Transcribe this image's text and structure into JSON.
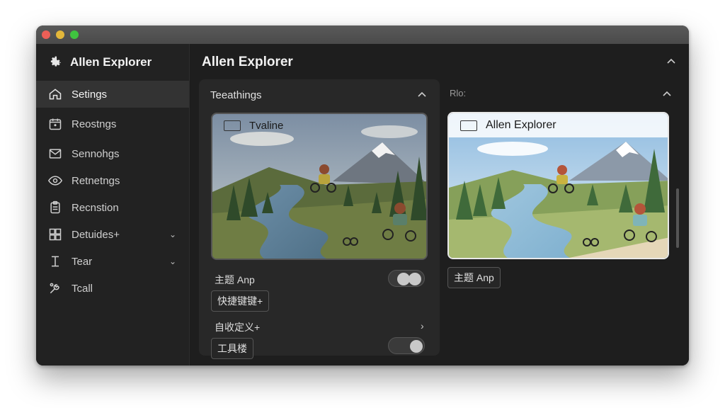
{
  "window": {
    "traffic_lights": [
      "close",
      "minimize",
      "maximize"
    ]
  },
  "sidebar": {
    "app_title": "Allen Explorer",
    "items": [
      {
        "label": "Setings",
        "icon": "home-icon",
        "active": true
      },
      {
        "label": "Reostngs",
        "icon": "calendar-icon"
      },
      {
        "label": "Sennohgs",
        "icon": "mail-icon"
      },
      {
        "label": "Retnetngs",
        "icon": "eye-icon"
      },
      {
        "label": "Recnstion",
        "icon": "clipboard-icon"
      },
      {
        "label": "Detuides+",
        "icon": "grid-icon",
        "chevron": "⌄"
      },
      {
        "label": "Tear",
        "icon": "text-cursor-icon",
        "chevron": "⌄"
      },
      {
        "label": "Tcall",
        "icon": "tools-icon"
      }
    ]
  },
  "main": {
    "title": "Allen Explorer",
    "left_panel": {
      "title": "Teeathings",
      "image_label": "Tvaline",
      "row1_label": "主题 Anp",
      "chip1": "快捷键键+",
      "row2_label": "自收定义+",
      "chip2": "工具楼"
    },
    "right_panel": {
      "title": "Rlo:",
      "image_label": "Allen Explorer",
      "chip": "主题 Anp"
    }
  },
  "colors": {
    "window_bg": "#1c1c1c",
    "sidebar_bg": "#222222",
    "panel_bg": "#282828",
    "active_item_bg": "#333333"
  }
}
